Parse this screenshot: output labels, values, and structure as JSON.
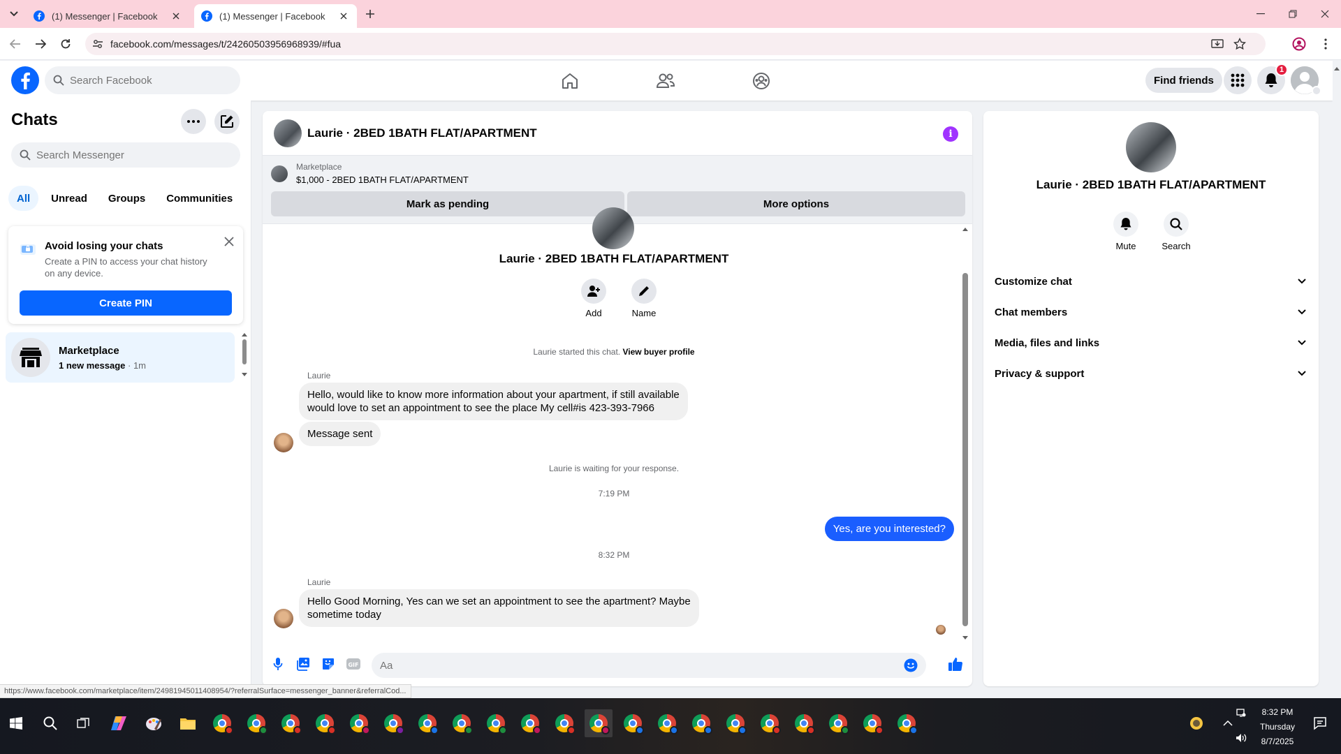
{
  "browser": {
    "tabs": [
      {
        "title": "(1) Messenger | Facebook",
        "active": false
      },
      {
        "title": "(1) Messenger | Facebook",
        "active": true
      }
    ],
    "url": "facebook.com/messages/t/24260503956968939/#fua",
    "status_url": "https://www.facebook.com/marketplace/item/24981945011408954/?referralSurface=messenger_banner&referralCod..."
  },
  "fb_nav": {
    "search_placeholder": "Search Facebook",
    "find_friends": "Find friends",
    "notification_count": "1",
    "brand_color": "#0866ff"
  },
  "chats_panel": {
    "title": "Chats",
    "search_placeholder": "Search Messenger",
    "filters": [
      "All",
      "Unread",
      "Groups",
      "Communities"
    ],
    "active_filter": "All",
    "pin_card": {
      "title": "Avoid losing your chats",
      "description": "Create a PIN to access your chat history on any device.",
      "button": "Create PIN"
    },
    "conversations": [
      {
        "name": "Marketplace",
        "preview": "1 new message",
        "time": " · 1m",
        "icon": "store-icon"
      }
    ]
  },
  "chat": {
    "title": "Laurie · 2BED 1BATH FLAT/APARTMENT",
    "marketplace": {
      "label": "Marketplace",
      "item": "$1,000 - 2BED 1BATH FLAT/APARTMENT",
      "mark_pending": "Mark as pending",
      "more_options": "More options"
    },
    "intro": {
      "name": "Laurie · 2BED 1BATH FLAT/APARTMENT",
      "add_label": "Add",
      "name_label": "Name"
    },
    "started_text": "Laurie started this chat.",
    "view_buyer": "View buyer profile",
    "messages": [
      {
        "sender": "Laurie",
        "text_line1": "Hello, would like to know more information about your apartment, if still available",
        "text_line2": "would love to set an appointment to see the place My cell#is  423-393-7966"
      },
      {
        "text": "Message sent"
      }
    ],
    "waiting_text": "Laurie is waiting for your response.",
    "time1": "7:19 PM",
    "outgoing": "Yes, are you interested?",
    "time2": "8:32 PM",
    "last_sender": "Laurie",
    "last_message_line1": "Hello Good Morning, Yes can we set an appointment to see the apartment? Maybe",
    "last_message_line2": "sometime today",
    "composer_placeholder": "Aa",
    "outgoing_color": "#1a5eff"
  },
  "info_panel": {
    "name": "Laurie · 2BED 1BATH FLAT/APARTMENT",
    "mute": "Mute",
    "search": "Search",
    "sections": [
      "Customize chat",
      "Chat members",
      "Media, files and links",
      "Privacy & support"
    ]
  },
  "taskbar": {
    "time": "8:32 PM",
    "day": "Thursday",
    "date": "8/7/2025"
  }
}
